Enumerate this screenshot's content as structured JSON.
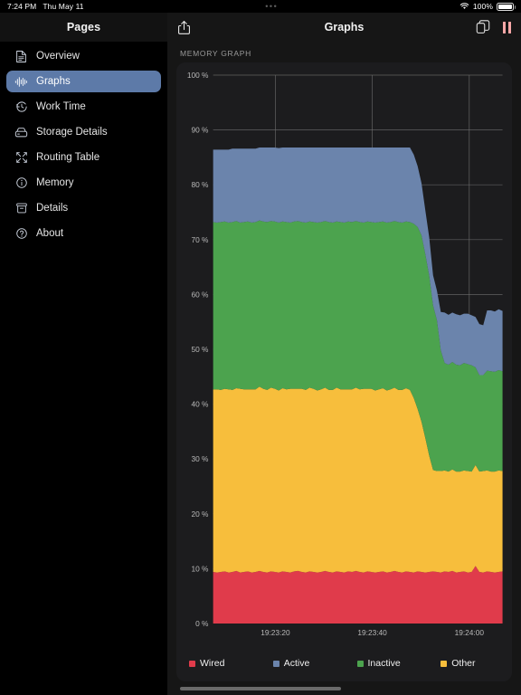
{
  "status_bar": {
    "time": "7:24 PM",
    "date": "Thu May 11",
    "battery_percent": "100%",
    "wifi_icon": "wifi-icon",
    "battery_icon": "battery-icon",
    "multitask_dots": "•••"
  },
  "nav": {
    "sidebar_title": "Pages",
    "title": "Graphs",
    "share_icon": "share-icon",
    "copy_icon": "copy-icon",
    "pause_icon": "pause-icon"
  },
  "sidebar": {
    "items": [
      {
        "label": "Overview",
        "icon": "document-icon",
        "selected": false
      },
      {
        "label": "Graphs",
        "icon": "waveform-icon",
        "selected": true
      },
      {
        "label": "Work Time",
        "icon": "clock-arrow-icon",
        "selected": false
      },
      {
        "label": "Storage Details",
        "icon": "drive-icon",
        "selected": false
      },
      {
        "label": "Routing Table",
        "icon": "arrows-expand-icon",
        "selected": false
      },
      {
        "label": "Memory",
        "icon": "info-circle-icon",
        "selected": false
      },
      {
        "label": "Details",
        "icon": "archivebox-icon",
        "selected": false
      },
      {
        "label": "About",
        "icon": "question-circle-icon",
        "selected": false
      }
    ]
  },
  "main": {
    "section_title": "Memory Graph"
  },
  "colors": {
    "wired": "#e03b4b",
    "active": "#6b84ac",
    "inactive": "#4ca34e",
    "other": "#f7be3c",
    "grid": "#6d6d6d",
    "plot_background": "#1c1c1e",
    "accent": "#5d7aa8"
  },
  "chart_data": {
    "type": "area",
    "stacked": true,
    "title": "Memory Graph",
    "xlabel": "",
    "ylabel": "",
    "ylim": [
      0,
      100
    ],
    "yticks": [
      "0 %",
      "10 %",
      "20 %",
      "30 %",
      "40 %",
      "50 %",
      "60 %",
      "70 %",
      "80 %",
      "90 %",
      "100 %"
    ],
    "ytick_values": [
      0,
      10,
      20,
      30,
      40,
      50,
      60,
      70,
      80,
      90,
      100
    ],
    "xticks": [
      "19:23:20",
      "19:23:40",
      "19:24:00"
    ],
    "xtick_positions": [
      0.215,
      0.55,
      0.885
    ],
    "grid": true,
    "legend_position": "bottom",
    "series": [
      {
        "name": "Wired",
        "color": "#e03b4b",
        "values": [
          9.4,
          9.3,
          9.4,
          9.5,
          9.3,
          9.4,
          9.6,
          9.3,
          9.4,
          9.5,
          9.3,
          9.4,
          9.6,
          9.4,
          9.3,
          9.5,
          9.4,
          9.3,
          9.5,
          9.4,
          9.3,
          9.5,
          9.6,
          9.4,
          9.3,
          9.5,
          9.4,
          9.3,
          9.4,
          9.6,
          9.4,
          9.3,
          9.5,
          9.4,
          9.3,
          9.5,
          9.4,
          9.6,
          9.4,
          9.3,
          9.5,
          9.4,
          9.3,
          9.4,
          9.5,
          9.3,
          9.4,
          9.6,
          9.4,
          9.3,
          9.5,
          9.4,
          9.3,
          9.5,
          9.4,
          9.3,
          9.4,
          9.5,
          9.4,
          9.3,
          9.5,
          9.4,
          9.6,
          9.3,
          9.4,
          9.5,
          9.3,
          9.4,
          10.5,
          9.4,
          9.3,
          9.5,
          9.4,
          9.3,
          9.4,
          9.5
        ]
      },
      {
        "name": "Other",
        "color": "#f7be3c",
        "values": [
          33.3,
          33.4,
          33.2,
          33.3,
          33.4,
          33.2,
          33.3,
          33.5,
          33.3,
          33.2,
          33.4,
          33.3,
          33.6,
          33.4,
          33.3,
          33.5,
          33.4,
          33.2,
          33.4,
          33.3,
          33.5,
          33.3,
          33.2,
          33.4,
          33.3,
          33.5,
          33.4,
          33.2,
          33.3,
          33.4,
          33.2,
          33.3,
          33.5,
          33.3,
          33.4,
          33.2,
          33.3,
          33.4,
          33.3,
          33.5,
          33.3,
          33.4,
          33.2,
          33.3,
          33.4,
          33.2,
          33.3,
          33.4,
          33.2,
          33.3,
          33.4,
          33.2,
          31.8,
          29.6,
          27.4,
          24.5,
          21.2,
          18.5,
          18.4,
          18.5,
          18.4,
          18.3,
          18.5,
          18.4,
          18.3,
          18.4,
          18.5,
          18.3,
          18.4,
          18.3,
          18.5,
          18.4,
          18.3,
          18.4,
          18.5,
          18.3
        ]
      },
      {
        "name": "Inactive",
        "color": "#4ca34e",
        "values": [
          30.5,
          30.4,
          30.6,
          30.5,
          30.4,
          30.6,
          30.5,
          30.3,
          30.5,
          30.6,
          30.4,
          30.5,
          30.3,
          30.5,
          30.6,
          30.4,
          30.5,
          30.6,
          30.4,
          30.5,
          30.3,
          30.5,
          30.6,
          30.4,
          30.5,
          30.3,
          30.4,
          30.6,
          30.5,
          30.4,
          30.6,
          30.5,
          30.3,
          30.5,
          30.4,
          30.6,
          30.5,
          30.4,
          30.5,
          30.3,
          30.5,
          30.4,
          30.6,
          30.5,
          30.4,
          30.6,
          30.5,
          30.4,
          30.6,
          30.5,
          30.4,
          30.6,
          31.8,
          33.2,
          34.0,
          33.5,
          32.8,
          30.0,
          27.5,
          22.0,
          19.6,
          19.5,
          19.6,
          19.5,
          19.4,
          19.6,
          19.5,
          19.4,
          17.8,
          17.6,
          17.5,
          18.2,
          18.3,
          18.2,
          18.3,
          18.2
        ]
      },
      {
        "name": "Active",
        "color": "#6b84ac",
        "values": [
          13.2,
          13.3,
          13.2,
          13.1,
          13.3,
          13.4,
          13.2,
          13.5,
          13.4,
          13.3,
          13.5,
          13.4,
          13.3,
          13.5,
          13.6,
          13.4,
          13.5,
          13.6,
          13.5,
          13.6,
          13.7,
          13.5,
          13.4,
          13.6,
          13.7,
          13.5,
          13.6,
          13.7,
          13.6,
          13.4,
          13.6,
          13.7,
          13.5,
          13.6,
          13.7,
          13.5,
          13.6,
          13.4,
          13.6,
          13.7,
          13.5,
          13.6,
          13.7,
          13.6,
          13.5,
          13.7,
          13.6,
          13.4,
          13.6,
          13.7,
          13.5,
          13.6,
          12.6,
          11.1,
          9.5,
          8.0,
          7.0,
          5.5,
          5.4,
          7.0,
          9.2,
          9.1,
          9.0,
          9.2,
          9.1,
          9.0,
          9.2,
          9.1,
          9.2,
          9.3,
          9.1,
          11.0,
          11.1,
          11.0,
          11.1,
          11.0
        ]
      }
    ]
  }
}
